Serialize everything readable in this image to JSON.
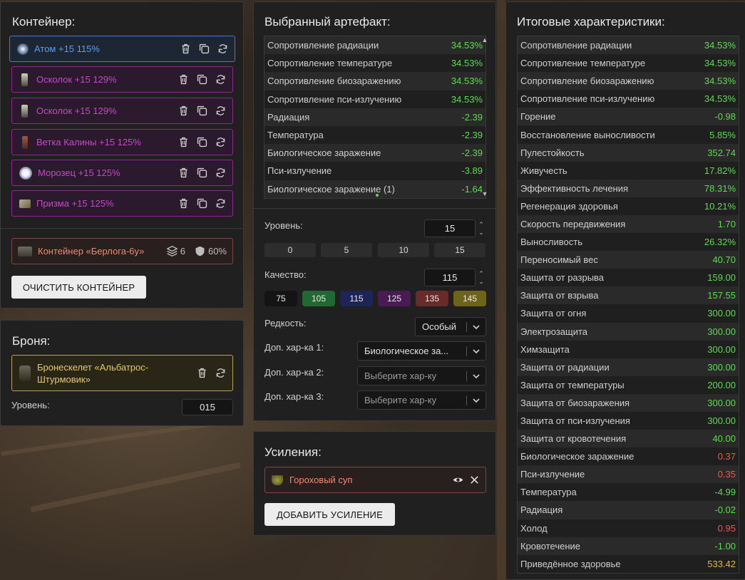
{
  "container": {
    "title": "Контейнер:",
    "items": [
      {
        "label": "Атом +15 115%",
        "icon": "atom-icon"
      },
      {
        "label": "Осколок +15 129%",
        "icon": "shard-icon"
      },
      {
        "label": "Осколок +15 129%",
        "icon": "shard-icon"
      },
      {
        "label": "Ветка Калины +15 125%",
        "icon": "branch-icon"
      },
      {
        "label": "Морозец +15 125%",
        "icon": "frost-icon"
      },
      {
        "label": "Призма +15 125%",
        "icon": "prism-icon"
      }
    ],
    "box": {
      "label": "Контейнер «Берлога-6у»",
      "slots": "6",
      "protection": "60%"
    },
    "clear_label": "ОЧИСТИТЬ КОНТЕЙНЕР"
  },
  "armor": {
    "title": "Броня:",
    "item_label": "Бронескелет «Альбатрос-Штурмовик»",
    "level_label": "Уровень:",
    "level_value": "015"
  },
  "artifact": {
    "title": "Выбранный артефакт:",
    "stats": [
      {
        "name": "Сопротивление радиации",
        "value": "34.53%"
      },
      {
        "name": "Сопротивление температуре",
        "value": "34.53%"
      },
      {
        "name": "Сопротивление биозаражению",
        "value": "34.53%"
      },
      {
        "name": "Сопротивление пси-излучению",
        "value": "34.53%"
      },
      {
        "name": "Радиация",
        "value": "-2.39"
      },
      {
        "name": "Температура",
        "value": "-2.39"
      },
      {
        "name": "Биологическое заражение",
        "value": "-2.39"
      },
      {
        "name": "Пси-излучение",
        "value": "-3.89"
      },
      {
        "name": "Биологическое заражение (1)",
        "value": "-1.64"
      }
    ],
    "level_label": "Уровень:",
    "level_value": "15",
    "level_presets": [
      "0",
      "5",
      "10",
      "15"
    ],
    "quality_label": "Качество:",
    "quality_value": "115",
    "quality_presets": [
      {
        "label": "75",
        "color": "#141414"
      },
      {
        "label": "105",
        "color": "#1f6a33"
      },
      {
        "label": "115",
        "color": "#1d2456"
      },
      {
        "label": "125",
        "color": "#4a1a55"
      },
      {
        "label": "135",
        "color": "#6a2a2a"
      },
      {
        "label": "145",
        "color": "#6e6418"
      }
    ],
    "rarity_label": "Редкость:",
    "rarity_value": "Особый",
    "extra1_label": "Доп. хар-ка 1:",
    "extra1_value": "Биологическое за...",
    "extra2_label": "Доп. хар-ка 2:",
    "extra2_placeholder": "Выберите хар-ку",
    "extra3_label": "Доп. хар-ка 3:",
    "extra3_placeholder": "Выберите хар-ку"
  },
  "boosts": {
    "title": "Усиления:",
    "item_label": "Гороховый суп",
    "add_label": "ДОБАВИТЬ УСИЛЕНИЕ"
  },
  "totals": {
    "title": "Итоговые характеристики:",
    "stats": [
      {
        "name": "Сопротивление радиации",
        "value": "34.53%",
        "tone": "green"
      },
      {
        "name": "Сопротивление температуре",
        "value": "34.53%",
        "tone": "green"
      },
      {
        "name": "Сопротивление биозаражению",
        "value": "34.53%",
        "tone": "green"
      },
      {
        "name": "Сопротивление пси-излучению",
        "value": "34.53%",
        "tone": "green"
      },
      {
        "name": "Горение",
        "value": "-0.98",
        "tone": "green"
      },
      {
        "name": "Восстановление выносливости",
        "value": "5.85%",
        "tone": "green"
      },
      {
        "name": "Пулестойкость",
        "value": "352.74",
        "tone": "green"
      },
      {
        "name": "Живучесть",
        "value": "17.82%",
        "tone": "green"
      },
      {
        "name": "Эффективность лечения",
        "value": "78.31%",
        "tone": "green"
      },
      {
        "name": "Регенерация здоровья",
        "value": "10.21%",
        "tone": "green"
      },
      {
        "name": "Скорость передвижения",
        "value": "1.70",
        "tone": "green"
      },
      {
        "name": "Выносливость",
        "value": "26.32%",
        "tone": "green"
      },
      {
        "name": "Переносимый вес",
        "value": "40.70",
        "tone": "green"
      },
      {
        "name": "Защита от разрыва",
        "value": "159.00",
        "tone": "green"
      },
      {
        "name": "Защита от взрыва",
        "value": "157.55",
        "tone": "green"
      },
      {
        "name": "Защита от огня",
        "value": "300.00",
        "tone": "green"
      },
      {
        "name": "Электрозащита",
        "value": "300.00",
        "tone": "green"
      },
      {
        "name": "Химзащита",
        "value": "300.00",
        "tone": "green"
      },
      {
        "name": "Защита от радиации",
        "value": "300.00",
        "tone": "green"
      },
      {
        "name": "Защита от температуры",
        "value": "200.00",
        "tone": "green"
      },
      {
        "name": "Защита от биозаражения",
        "value": "300.00",
        "tone": "green"
      },
      {
        "name": "Защита от пси-излучения",
        "value": "300.00",
        "tone": "green"
      },
      {
        "name": "Защита от кровотечения",
        "value": "40.00",
        "tone": "green"
      },
      {
        "name": "Биологическое заражение",
        "value": "0.37",
        "tone": "red"
      },
      {
        "name": "Пси-излучение",
        "value": "0.35",
        "tone": "red"
      },
      {
        "name": "Температура",
        "value": "-4.99",
        "tone": "green"
      },
      {
        "name": "Радиация",
        "value": "-0.02",
        "tone": "green"
      },
      {
        "name": "Холод",
        "value": "0.95",
        "tone": "red"
      },
      {
        "name": "Кровотечение",
        "value": "-1.00",
        "tone": "green"
      },
      {
        "name": "Приведённое здоровье",
        "value": "533.42",
        "tone": "gold"
      }
    ]
  },
  "colors": {
    "selected_border": "#3b7be0",
    "rare_border": "#8c2a8c",
    "green_value": "#5ddb4f",
    "red_value": "#e85a4f",
    "gold_value": "#e0b63b"
  }
}
